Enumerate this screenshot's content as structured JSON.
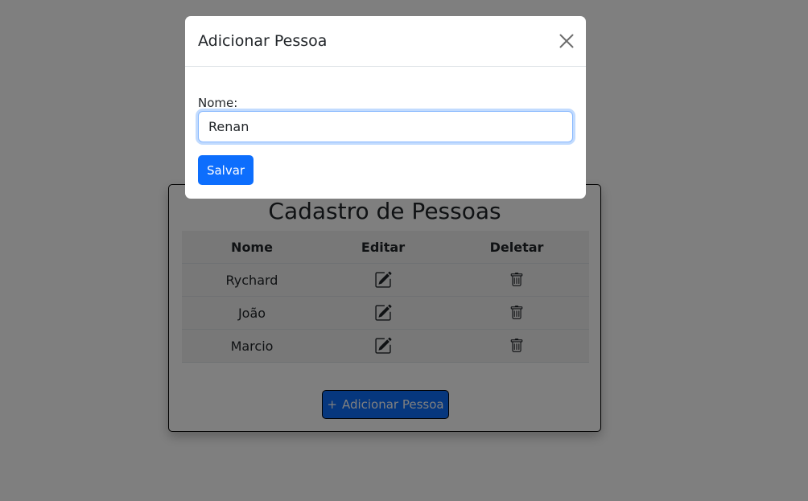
{
  "page": {
    "title": "Cadastro de Pessoas",
    "table": {
      "headers": [
        "Nome",
        "Editar",
        "Deletar"
      ],
      "rows": [
        {
          "name": "Rychard"
        },
        {
          "name": "João"
        },
        {
          "name": "Marcio"
        }
      ]
    },
    "add_button": {
      "icon_text": "+",
      "label": "Adicionar Pessoa"
    }
  },
  "modal": {
    "title": "Adicionar Pessoa",
    "close_icon": "close-icon",
    "field_label": "Nome:",
    "input_value": "Renan",
    "save_label": "Salvar"
  },
  "icons": {
    "edit": "pencil-square-icon",
    "delete": "trash-icon"
  },
  "colors": {
    "primary": "#0d6efd",
    "backdrop": "rgba(0,0,0,0.5)",
    "focus_border": "#86b7fe"
  }
}
